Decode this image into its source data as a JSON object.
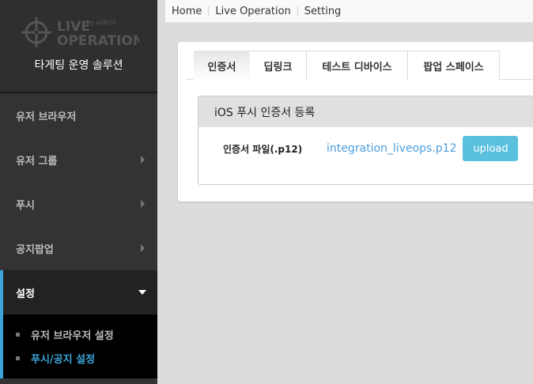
{
  "sidebar": {
    "logo_text": "LIVE OPERATION by adbrix",
    "tagline": "타게팅 운영 솔루션",
    "menu": [
      {
        "label": "유저 브라우저"
      },
      {
        "label": "유저 그룹"
      },
      {
        "label": "푸시"
      },
      {
        "label": "공지팝업"
      },
      {
        "label": "설정"
      }
    ],
    "submenu": [
      {
        "label": "유저 브라우저 설정"
      },
      {
        "label": "푸시/공지 설정"
      }
    ]
  },
  "breadcrumb": [
    "Home",
    "Live Operation",
    "Setting"
  ],
  "tabs": [
    "인증서",
    "딥링크",
    "테스트 디바이스",
    "팝업 스페이스"
  ],
  "section": {
    "title": "iOS 푸시 인증서 등록",
    "field_label": "인증서 파일(.p12)",
    "file_name": "integration_liveops.p12",
    "upload_label": "upload"
  },
  "colors": {
    "accent": "#3aa6d8",
    "button": "#5bc0de"
  }
}
